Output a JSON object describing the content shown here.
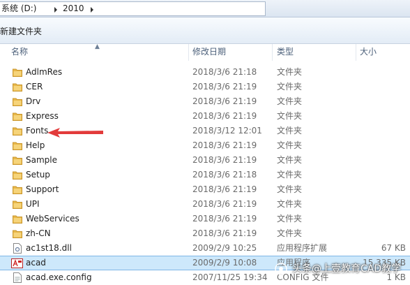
{
  "address_bar": {
    "crumbs": [
      "系统 (D:)",
      "2010"
    ]
  },
  "toolbar": {
    "new_folder_label": "新建文件夹"
  },
  "columns": {
    "name": "名称",
    "date": "修改日期",
    "type": "类型",
    "size": "大小"
  },
  "files": [
    {
      "name": "AdlmRes",
      "date": "2018/3/6 21:18",
      "type": "文件夹",
      "size": "",
      "icon": "folder-icon"
    },
    {
      "name": "CER",
      "date": "2018/3/6 21:19",
      "type": "文件夹",
      "size": "",
      "icon": "folder-icon"
    },
    {
      "name": "Drv",
      "date": "2018/3/6 21:19",
      "type": "文件夹",
      "size": "",
      "icon": "folder-icon"
    },
    {
      "name": "Express",
      "date": "2018/3/6 21:19",
      "type": "文件夹",
      "size": "",
      "icon": "folder-icon"
    },
    {
      "name": "Fonts",
      "date": "2018/3/12 12:01",
      "type": "文件夹",
      "size": "",
      "icon": "folder-icon"
    },
    {
      "name": "Help",
      "date": "2018/3/6 21:19",
      "type": "文件夹",
      "size": "",
      "icon": "folder-icon"
    },
    {
      "name": "Sample",
      "date": "2018/3/6 21:19",
      "type": "文件夹",
      "size": "",
      "icon": "folder-icon"
    },
    {
      "name": "Setup",
      "date": "2018/3/6 21:18",
      "type": "文件夹",
      "size": "",
      "icon": "folder-icon"
    },
    {
      "name": "Support",
      "date": "2018/3/6 21:19",
      "type": "文件夹",
      "size": "",
      "icon": "folder-icon"
    },
    {
      "name": "UPI",
      "date": "2018/3/6 21:19",
      "type": "文件夹",
      "size": "",
      "icon": "folder-icon"
    },
    {
      "name": "WebServices",
      "date": "2018/3/6 21:19",
      "type": "文件夹",
      "size": "",
      "icon": "folder-icon"
    },
    {
      "name": "zh-CN",
      "date": "2018/3/6 21:19",
      "type": "文件夹",
      "size": "",
      "icon": "folder-icon"
    },
    {
      "name": "ac1st18.dll",
      "date": "2009/2/9 10:25",
      "type": "应用程序扩展",
      "size": "67 KB",
      "icon": "dll-file-icon"
    },
    {
      "name": "acad",
      "date": "2009/2/9 10:08",
      "type": "应用程序",
      "size": "15,335 KB",
      "icon": "autocad-app-icon",
      "selected": true
    },
    {
      "name": "acad.exe.config",
      "date": "2007/11/25 19:34",
      "type": "CONFIG 文件",
      "size": "1 KB",
      "icon": "config-file-icon"
    }
  ],
  "watermark": {
    "text": "头条@上壹教育CAD教学"
  },
  "colors": {
    "selection": "#cde8fb",
    "folder": "#e8b84a",
    "arrow": "#e23b3b"
  }
}
